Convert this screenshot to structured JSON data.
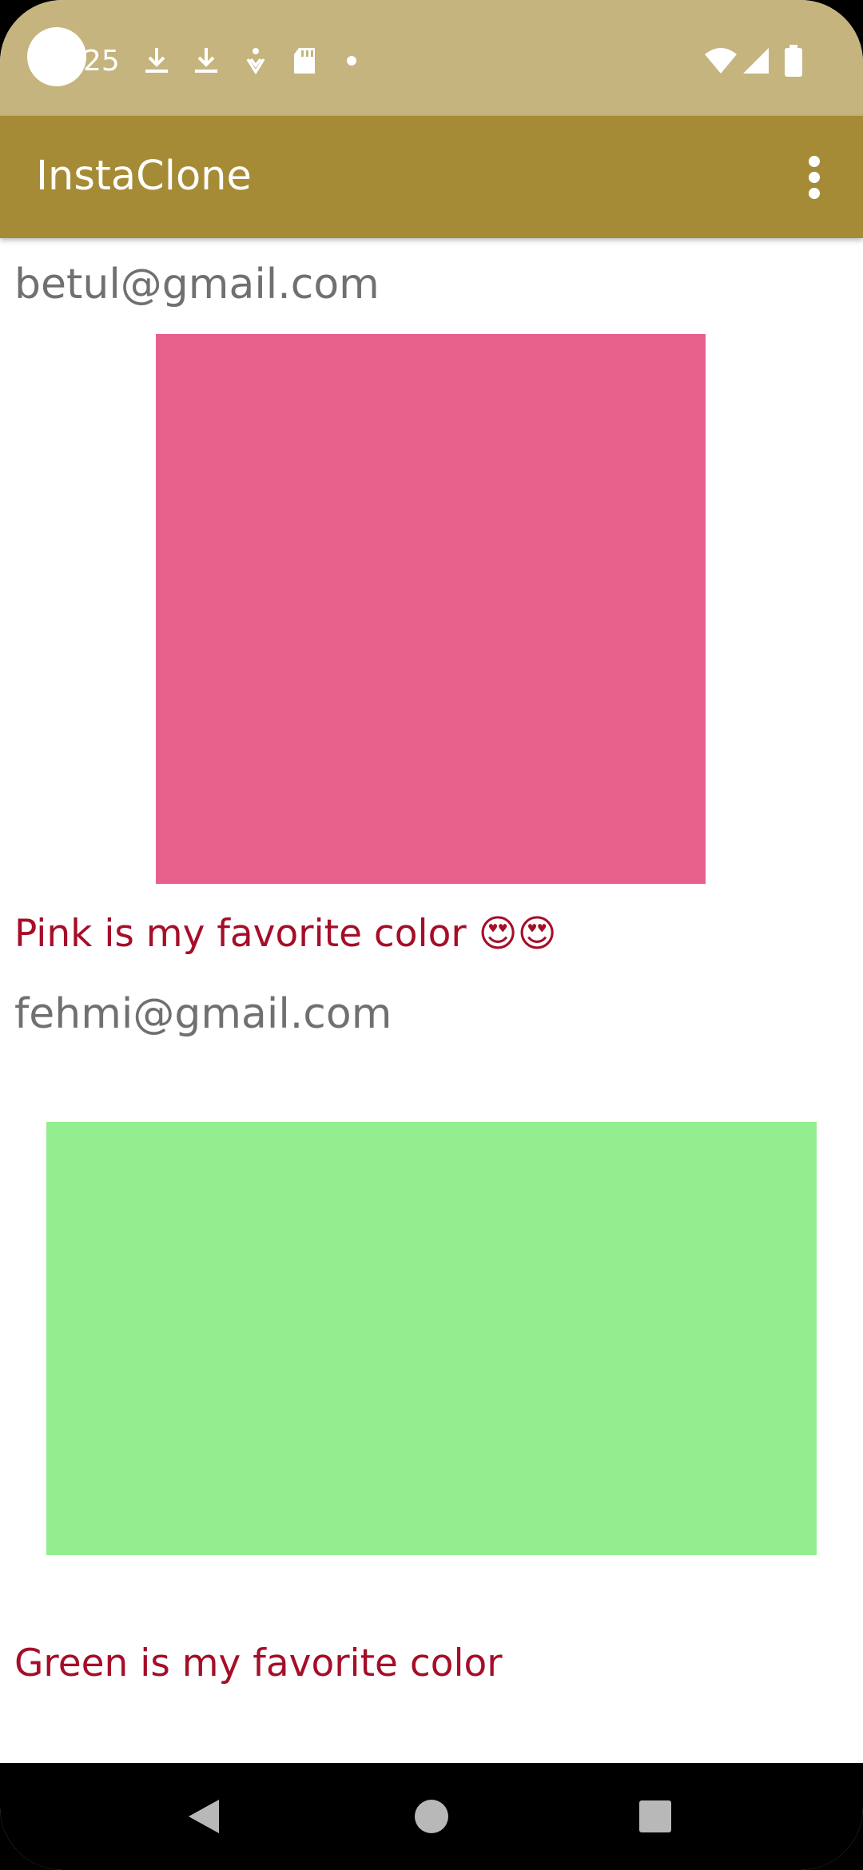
{
  "status_bar": {
    "time": "25",
    "icons": [
      "download-icon",
      "download-icon",
      "accessibility-icon",
      "sd-card-icon",
      "dot-icon",
      "wifi-icon",
      "signal-icon",
      "battery-icon"
    ]
  },
  "app_bar": {
    "title": "InstaClone",
    "menu_icon": "more-vert-icon"
  },
  "posts": [
    {
      "email": "betul@gmail.com",
      "image_color": "#e7608c",
      "comment": "Pink is my favorite color 😍😍"
    },
    {
      "email": "fehmi@gmail.com",
      "image_color": "#93ee8f",
      "comment": "Green is my favorite color"
    }
  ],
  "nav_bar": {
    "back_icon": "back-triangle-icon",
    "home_icon": "home-circle-icon",
    "recents_icon": "recents-square-icon"
  },
  "colors": {
    "status_bar": "#c5b47e",
    "app_bar": "#a68b36",
    "email_text": "#707070",
    "comment_text": "#a50e28"
  }
}
